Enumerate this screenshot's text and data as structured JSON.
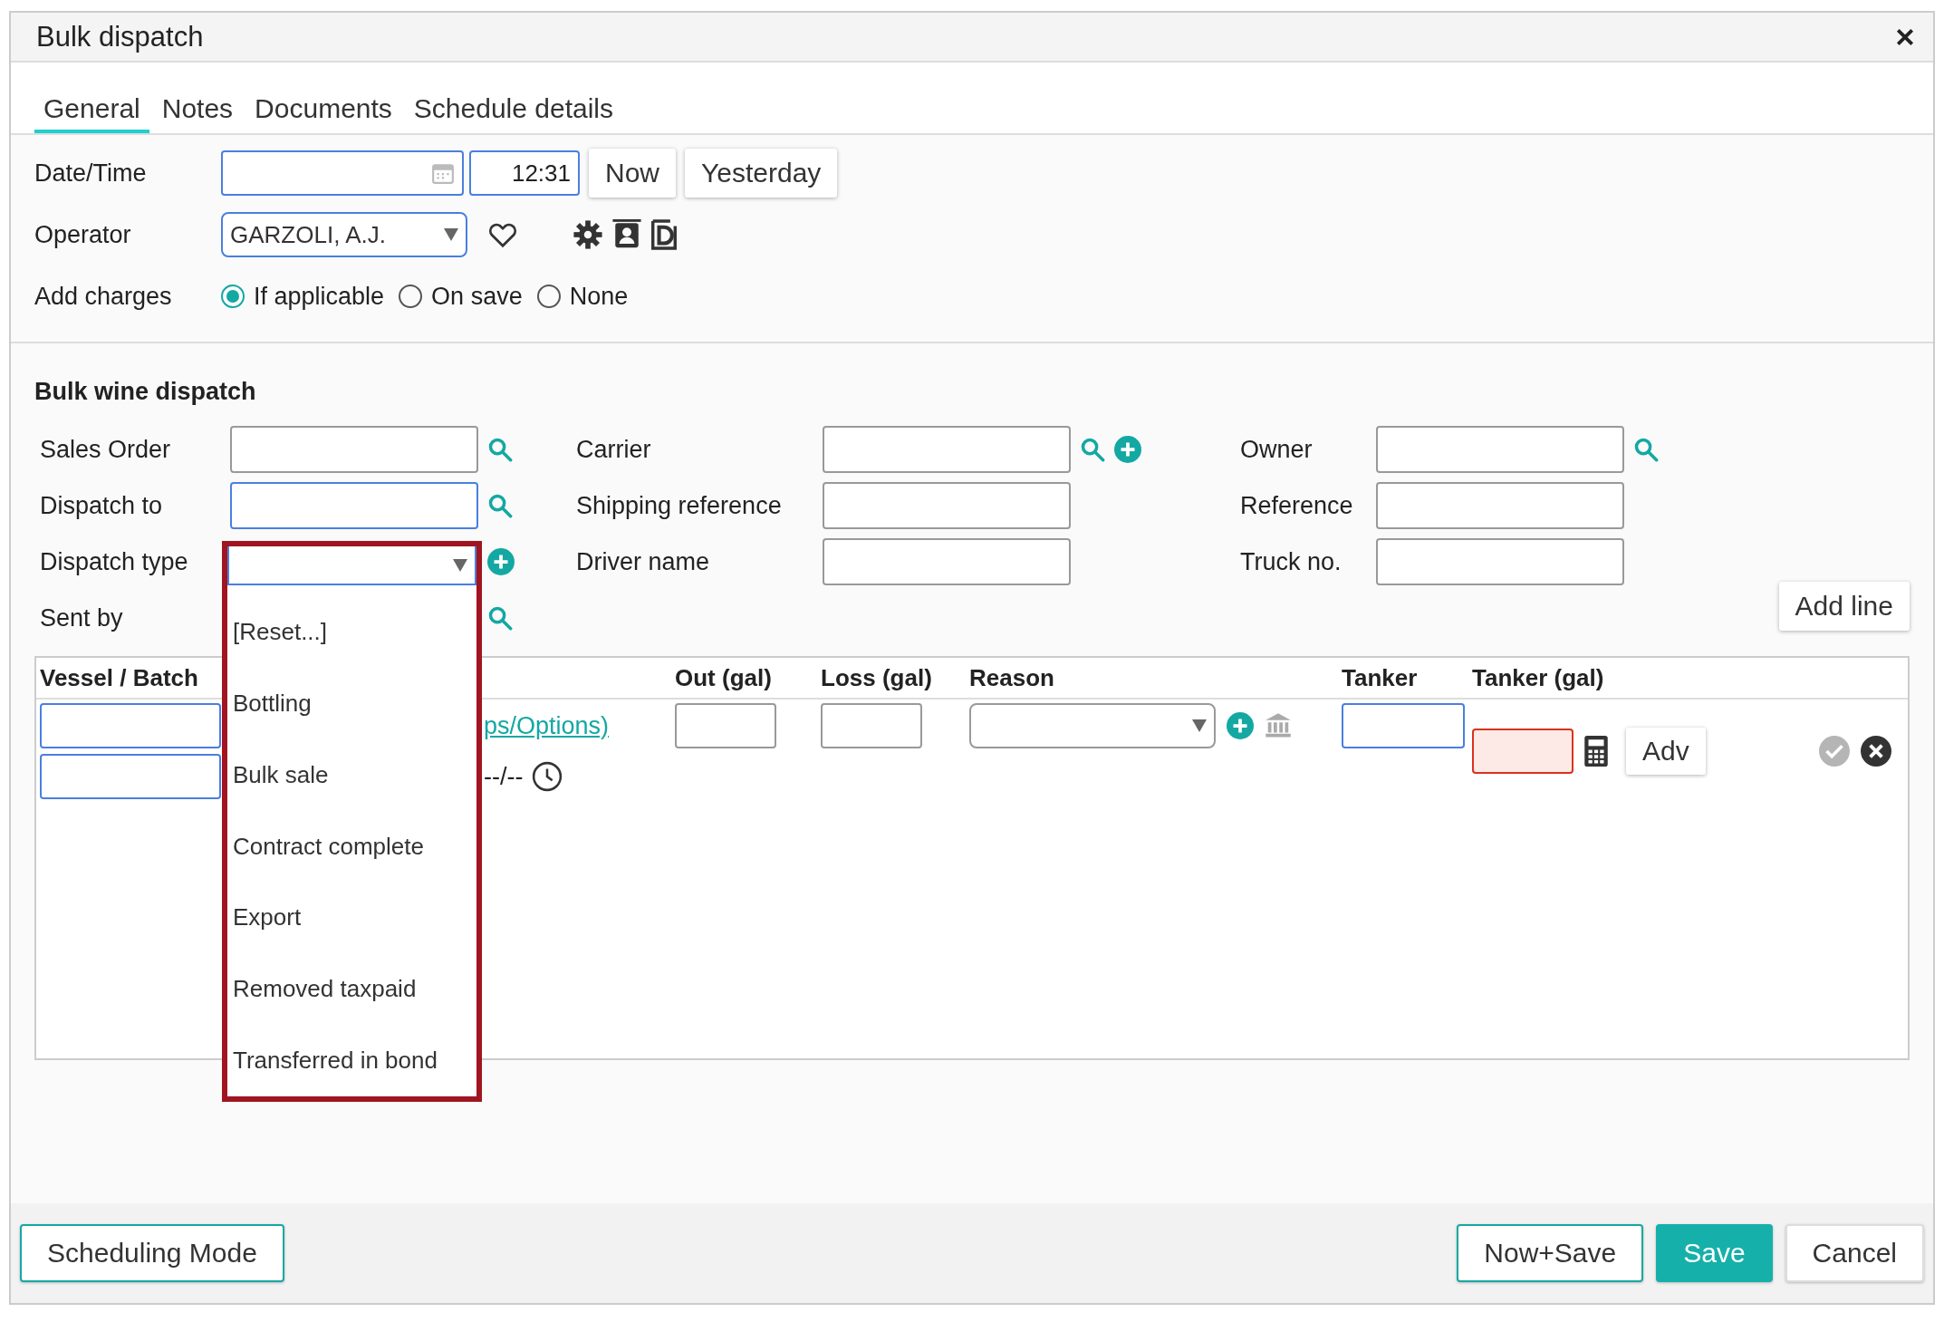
{
  "window": {
    "title": "Bulk dispatch"
  },
  "tabs": [
    {
      "label": "General",
      "selected": true
    },
    {
      "label": "Notes",
      "selected": false
    },
    {
      "label": "Documents",
      "selected": false
    },
    {
      "label": "Schedule details",
      "selected": false
    }
  ],
  "general": {
    "date_time": {
      "label": "Date/Time",
      "time": "12:31",
      "buttons": [
        "Now",
        "Yesterday"
      ]
    },
    "operator": {
      "label": "Operator",
      "value": "GARZOLI, A.J."
    },
    "add_charges": {
      "label": "Add charges",
      "options": [
        {
          "label": "If applicable",
          "selected": true
        },
        {
          "label": "On save",
          "selected": false
        },
        {
          "label": "None",
          "selected": false
        }
      ]
    }
  },
  "section": {
    "title": "Bulk wine dispatch",
    "columns": [
      [
        {
          "label": "Sales Order",
          "kind": "search",
          "highlighted": false
        },
        {
          "label": "Dispatch to",
          "kind": "search",
          "highlighted": true
        },
        {
          "label": "Dispatch type",
          "kind": "covered_add"
        },
        {
          "label": "Sent by",
          "kind": "covered_search"
        }
      ],
      [
        {
          "label": "Carrier",
          "kind": "search_add",
          "highlighted": false
        },
        {
          "label": "Shipping reference",
          "kind": "text",
          "highlighted": false
        },
        {
          "label": "Driver name",
          "kind": "text",
          "highlighted": false
        }
      ],
      [
        {
          "label": "Owner",
          "kind": "search",
          "highlighted": false
        },
        {
          "label": "Reference",
          "kind": "text",
          "highlighted": false
        },
        {
          "label": "Truck no.",
          "kind": "text",
          "highlighted": false
        }
      ]
    ],
    "add_line": "Add line"
  },
  "dispatch_type_menu": {
    "options": [
      "[Reset...]",
      "Bottling",
      "Bulk sale",
      "Contract complete",
      "Export",
      "Removed taxpaid",
      "Transferred in bond"
    ]
  },
  "table": {
    "columns": [
      "Vessel / Batch",
      "Out (gal)",
      "Loss (gal)",
      "Reason",
      "Tanker",
      "Tanker (gal)"
    ],
    "row": {
      "link": "ps/Options)",
      "time": "--/--",
      "tanker_gal_invalid": true,
      "adv": "Adv"
    }
  },
  "footer": {
    "left": [
      {
        "label": "Scheduling Mode",
        "kind": "outline"
      }
    ],
    "right": [
      {
        "label": "Now+Save",
        "kind": "outline"
      },
      {
        "label": "Save",
        "kind": "primary"
      },
      {
        "label": "Cancel",
        "kind": "plain"
      }
    ]
  }
}
